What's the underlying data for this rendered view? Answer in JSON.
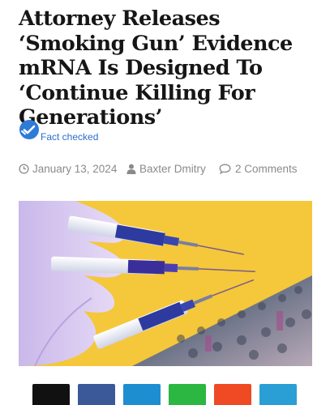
{
  "article": {
    "title": "Attorney Releases ‘Smoking Gun’ Evidence mRNA Is Designed To ‘Continue Killing For Generations’",
    "fact_check_label": "Fact checked",
    "date": "January 13, 2024",
    "author": "Baxter Dmitry",
    "comments": "2 Comments"
  },
  "icons": {
    "fact_check": "fact-check-badge-icon",
    "date": "clock-icon",
    "author": "user-icon",
    "comments": "comment-bubble-icon"
  },
  "image": {
    "description_colors": {
      "background": "#f5c73a",
      "glove": "#d8c8ef",
      "syringe_plunger": "#2d3aa0",
      "needle": "#7a5a8a"
    }
  },
  "share_bar": {
    "buttons": [
      {
        "name": "share-x",
        "color": "#111111"
      },
      {
        "name": "share-facebook",
        "color": "#3b5998"
      },
      {
        "name": "share-linkedin",
        "color": "#1d8fd1"
      },
      {
        "name": "share-whatsapp",
        "color": "#2bb741"
      },
      {
        "name": "share-reddit",
        "color": "#ef4a23"
      },
      {
        "name": "share-telegram",
        "color": "#2a9fd6"
      }
    ]
  },
  "colors": {
    "accent": "#2e7bd8",
    "meta_text": "#8a8a8a",
    "title_text": "#161616"
  }
}
